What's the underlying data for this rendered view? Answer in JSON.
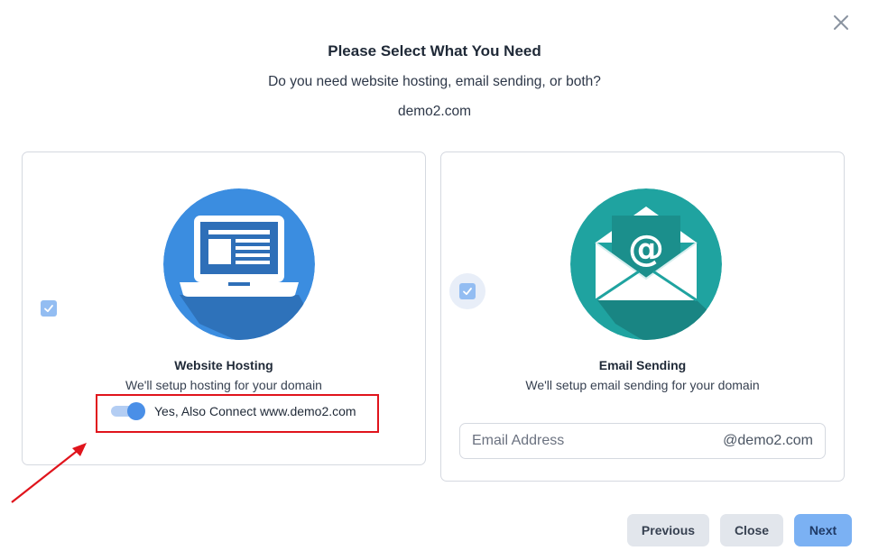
{
  "dialog": {
    "title": "Please Select What You Need",
    "subtitle": "Do you need website hosting, email sending, or both?",
    "domain": "demo2.com"
  },
  "hosting_card": {
    "title": "Website Hosting",
    "description": "We'll setup hosting for your domain",
    "checked": true,
    "toggle_label": "Yes, Also Connect www.demo2.com",
    "toggle_on": true,
    "icon": "laptop-icon",
    "icon_color": "#3b8de0"
  },
  "email_card": {
    "title": "Email Sending",
    "description": "We'll setup email sending for your domain",
    "checked": true,
    "icon": "envelope-at-icon",
    "icon_color": "#1fa3a0",
    "email_placeholder": "Email Address",
    "email_suffix": "@demo2.com"
  },
  "footer": {
    "previous_label": "Previous",
    "close_label": "Close",
    "next_label": "Next"
  },
  "colors": {
    "accent": "#4a8fe7",
    "next_button": "#7bb1f3",
    "annotation_red": "#e0141c"
  }
}
